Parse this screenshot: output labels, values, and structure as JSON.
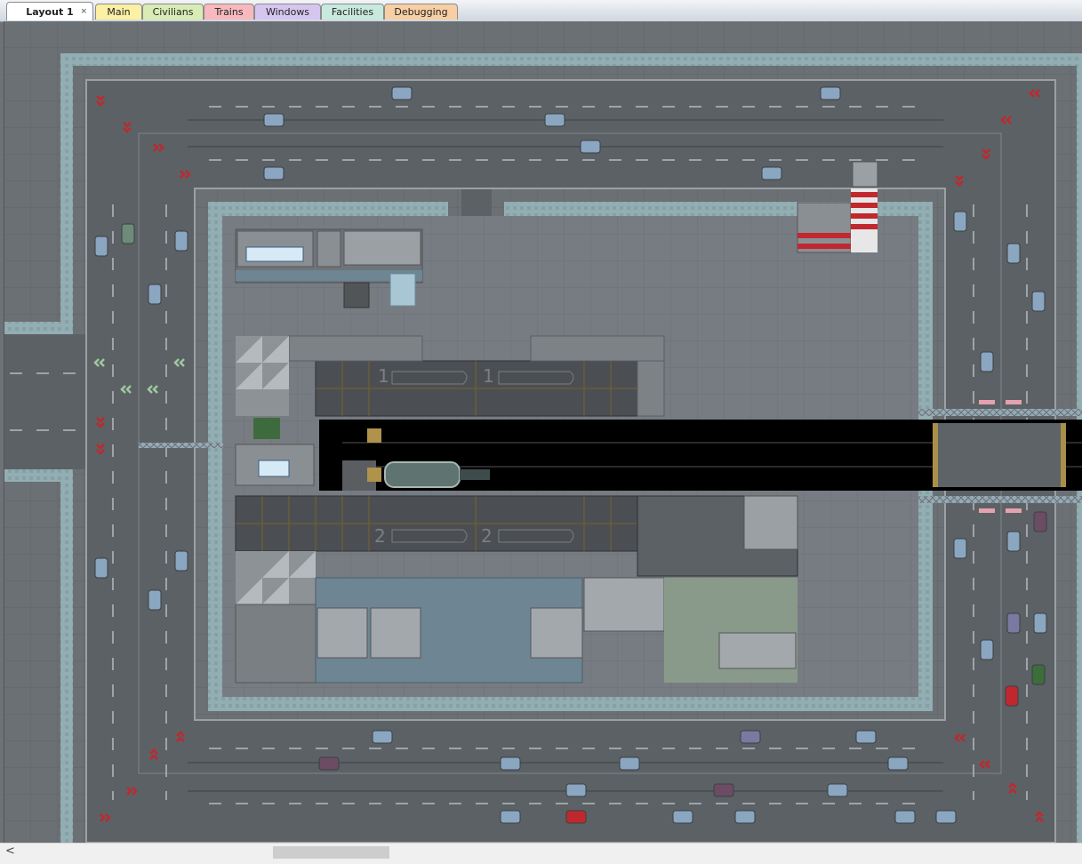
{
  "tabs": [
    {
      "label": "Layout 1",
      "color": "#ffffff",
      "active": true,
      "close": "×"
    },
    {
      "label": "Main",
      "color": "#fbf0a4"
    },
    {
      "label": "Civilians",
      "color": "#d9ecb5"
    },
    {
      "label": "Trains",
      "color": "#f7b9bd"
    },
    {
      "label": "Windows",
      "color": "#d6c6ef"
    },
    {
      "label": "Facilities",
      "color": "#c8e9dd"
    },
    {
      "label": "Debugging",
      "color": "#f8cfa4"
    }
  ],
  "station_signs": {
    "platform_1_left": "1",
    "platform_1_right": "1",
    "platform_2_left": "2",
    "platform_2_right": "2"
  },
  "scrollbar": {
    "left_arrow": "<"
  },
  "colors": {
    "ground": "#6b7074",
    "road": "#5c6165",
    "curb": "#8fa9ad",
    "building_floor": "#757a80",
    "track": "#000000",
    "car_blue": "#8aa6c0",
    "car_red": "#c0282e",
    "car_purple": "#6b4c63",
    "car_green": "#3b6e3b",
    "chevron_red": "#c0282e",
    "chevron_green": "#9ec89e"
  },
  "icons": [
    "close-icon",
    "chevron-left-icon",
    "train-icon",
    "car-icon",
    "road-arrow-icon"
  ]
}
